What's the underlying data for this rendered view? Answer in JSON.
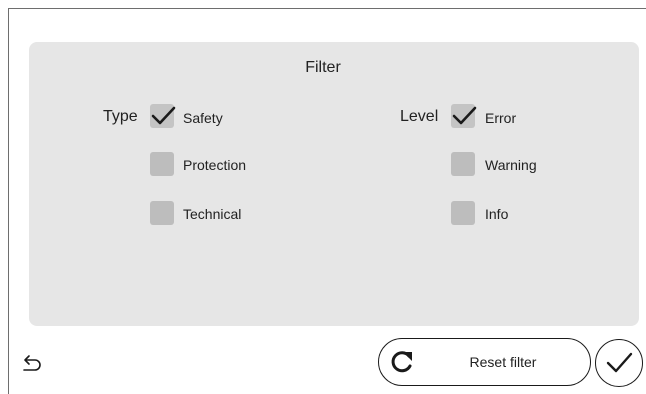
{
  "panel": {
    "title": "Filter"
  },
  "type_group": {
    "label": "Type",
    "options": [
      {
        "label": "Safety",
        "checked": true
      },
      {
        "label": "Protection",
        "checked": false
      },
      {
        "label": "Technical",
        "checked": false
      }
    ]
  },
  "level_group": {
    "label": "Level",
    "options": [
      {
        "label": "Error",
        "checked": true
      },
      {
        "label": "Warning",
        "checked": false
      },
      {
        "label": "Info",
        "checked": false
      }
    ]
  },
  "footer": {
    "reset_label": "Reset filter",
    "back_icon": "undo-arrow-icon",
    "reset_icon": "refresh-icon",
    "confirm_icon": "checkmark-icon"
  },
  "colors": {
    "panel_bg": "#e6e6e6",
    "checkbox_bg": "#bdbdbd",
    "text": "#1a1a1a"
  }
}
